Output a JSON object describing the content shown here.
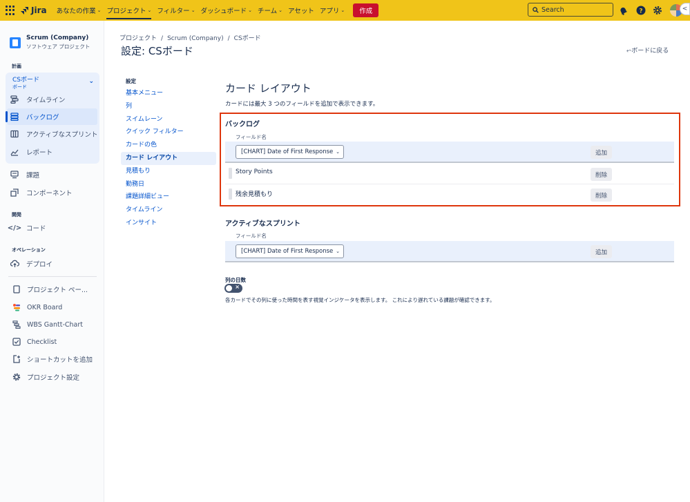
{
  "topnav": {
    "product": "Jira",
    "items": [
      "あなたの作業",
      "プロジェクト",
      "フィルター",
      "ダッシュボード",
      "チーム",
      "アセット",
      "アプリ"
    ],
    "create": "作成",
    "search_placeholder": "Search"
  },
  "sidebar": {
    "project_name": "Scrum (Company)",
    "project_type": "ソフトウェア プロジェクト",
    "section_plan": "計画",
    "board_name": "CSボード",
    "board_type": "ボード",
    "plan_items": [
      "タイムライン",
      "バックログ",
      "アクティブなスプリント",
      "レポート"
    ],
    "misc_items": [
      "課題",
      "コンポーネント"
    ],
    "section_dev": "開発",
    "dev_items": [
      "コード"
    ],
    "section_ops": "オペレーション",
    "ops_items": [
      "デプロイ"
    ],
    "extra_items": [
      "プロジェクト ペー...",
      "OKR Board",
      "WBS Gantt-Chart",
      "Checklist",
      "ショートカットを追加",
      "プロジェクト設定"
    ]
  },
  "breadcrumb": [
    "プロジェクト",
    "/",
    "Scrum (Company)",
    "/",
    "CSボード"
  ],
  "page_title": "設定: CSボード",
  "back_link": "ボードに戻る",
  "settings_nav": {
    "header": "設定",
    "items": [
      "基本メニュー",
      "列",
      "スイムレーン",
      "クイック フィルター",
      "カードの色",
      "カード レイアウト",
      "見積もり",
      "勤務日",
      "課題詳細ビュー",
      "タイムライン",
      "インサイト"
    ],
    "active_index": 5
  },
  "card_layout": {
    "title": "カード レイアウト",
    "description": "カードには最大 3 つのフィールドを追加で表示できます。",
    "backlog": {
      "heading": "バックログ",
      "field_label": "フィールド名",
      "select_value": "[CHART] Date of First Response",
      "add_label": "追加",
      "fields": [
        {
          "name": "Story Points",
          "action": "削除"
        },
        {
          "name": "残余見積もり",
          "action": "削除"
        }
      ]
    },
    "active_sprint": {
      "heading": "アクティブなスプリント",
      "field_label": "フィールド名",
      "select_value": "[CHART] Date of First Response",
      "add_label": "追加"
    },
    "days_in_column": {
      "label": "列の日数",
      "toggle_on": false,
      "description": "各カードでその列に使った時間を表す視覚インジケータを表示します。 これにより遅れている課題が確認できます。"
    }
  }
}
